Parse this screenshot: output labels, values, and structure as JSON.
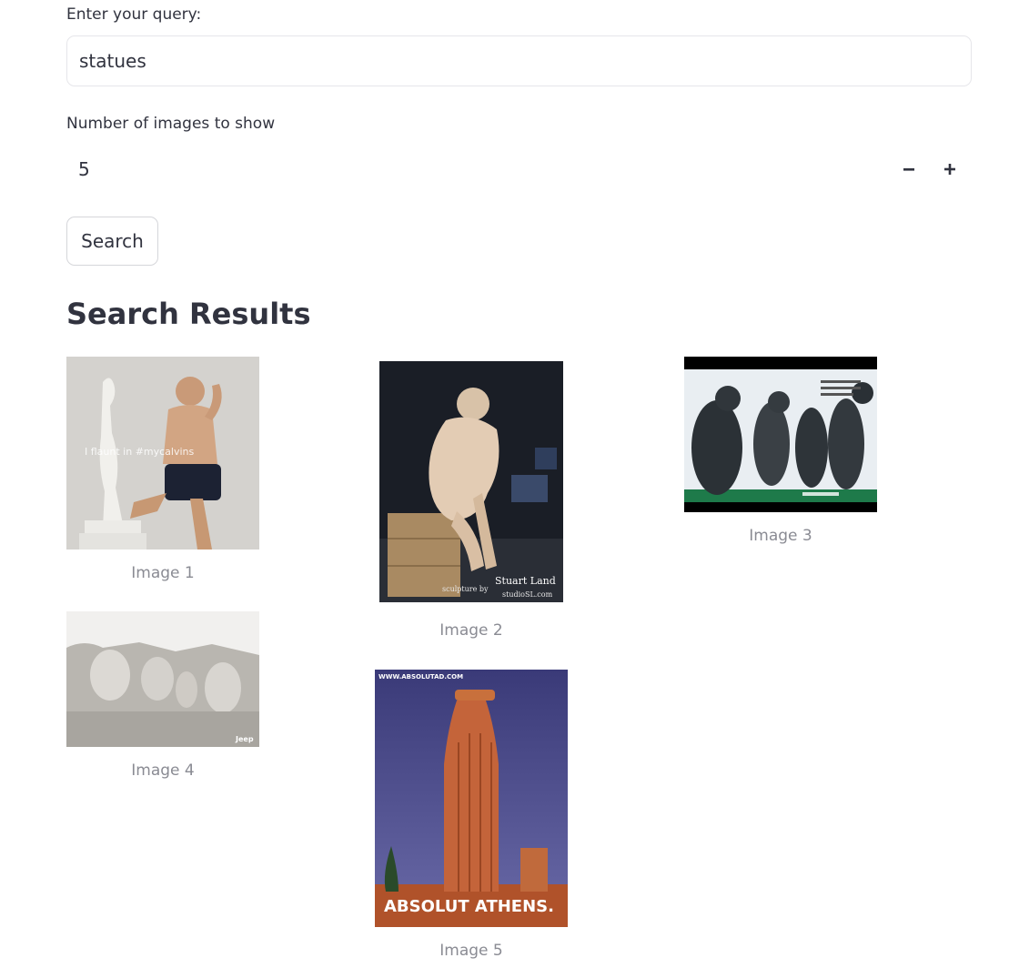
{
  "query": {
    "label": "Enter your query:",
    "value": "statues"
  },
  "count": {
    "label": "Number of images to show",
    "value": "5",
    "decrement_icon": "minus-icon",
    "increment_icon": "plus-icon"
  },
  "search_button": {
    "label": "Search"
  },
  "results": {
    "title": "Search Results",
    "items": [
      {
        "caption": "Image 1",
        "overlay_text": "I    flaunt    in #mycalvins"
      },
      {
        "caption": "Image 2",
        "overlay_text_1": "sculpture by",
        "overlay_text_2": "Stuart Land",
        "overlay_text_3": "studioSL.com"
      },
      {
        "caption": "Image 3"
      },
      {
        "caption": "Image 4",
        "overlay_text": "Jeep"
      },
      {
        "caption": "Image 5",
        "overlay_text_1": "WWW.ABSOLUTAD.COM",
        "overlay_text_2": "ABSOLUT ATHENS."
      }
    ]
  },
  "colors": {
    "text": "#31333f",
    "caption": "#8a8b93",
    "border": "#e6e6ea"
  }
}
